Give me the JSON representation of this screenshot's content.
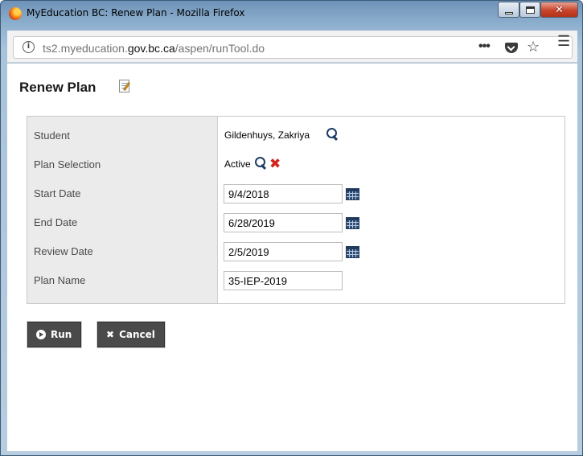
{
  "window": {
    "title": "MyEducation BC: Renew Plan - Mozilla Firefox",
    "minimize_icon": "minimize-icon",
    "maximize_icon": "maximize-icon",
    "close_glyph": "✕"
  },
  "browser": {
    "url_prefix": "ts2.myeducation.",
    "url_domain": "gov.bc.ca",
    "url_path": "/aspen/runTool.do",
    "info_glyph": "i",
    "more_glyph": "•••",
    "star_glyph": "☆",
    "menu_glyph": "☰"
  },
  "page": {
    "title": "Renew Plan",
    "title_icon": "edit-document-icon"
  },
  "form": {
    "student_label": "Student",
    "student_value": "Gildenhuys, Zakriya",
    "plan_selection_label": "Plan Selection",
    "plan_selection_value": "Active",
    "start_date_label": "Start Date",
    "start_date_value": "9/4/2018",
    "end_date_label": "End Date",
    "end_date_value": "6/28/2019",
    "review_date_label": "Review Date",
    "review_date_value": "2/5/2019",
    "plan_name_label": "Plan Name",
    "plan_name_value": "35-IEP-2019",
    "clear_glyph": "✖"
  },
  "buttons": {
    "run_label": "Run",
    "cancel_label": "Cancel",
    "cancel_glyph": "✖"
  },
  "colors": {
    "button_bg": "#4a4a4a",
    "label_column_bg": "#ebebeb",
    "clear_icon": "#d4241c",
    "lookup_icon": "#1e3c64"
  }
}
